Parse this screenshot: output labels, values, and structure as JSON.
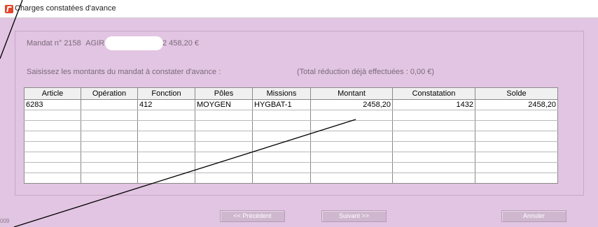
{
  "window": {
    "title": "Charges constatées d'avance",
    "icon": "app-logo-icon"
  },
  "mandat": {
    "label": "Mandat n° 2158",
    "entity": "AGIR",
    "amount": "2 458,20 €"
  },
  "instructions": "Saisissez les montants du mandat à constater d'avance :",
  "total_reduction": "(Total réduction déjà effectuées : 0,00 €)",
  "table": {
    "columns": [
      "Article",
      "Opération",
      "Fonction",
      "Pôles",
      "Missions",
      "Montant",
      "Constatation",
      "Solde"
    ],
    "rows": [
      [
        "6283",
        "",
        "412",
        "MOYGEN",
        "HYGBAT-1",
        "2458,20",
        "1432",
        "2458,20"
      ],
      [
        "",
        "",
        "",
        "",
        "",
        "",
        "",
        ""
      ],
      [
        "",
        "",
        "",
        "",
        "",
        "",
        "",
        ""
      ],
      [
        "",
        "",
        "",
        "",
        "",
        "",
        "",
        ""
      ],
      [
        "",
        "",
        "",
        "",
        "",
        "",
        "",
        ""
      ],
      [
        "",
        "",
        "",
        "",
        "",
        "",
        "",
        ""
      ],
      [
        "",
        "",
        "",
        "",
        "",
        "",
        "",
        ""
      ],
      [
        "",
        "",
        "",
        "",
        "",
        "",
        "",
        ""
      ]
    ]
  },
  "buttons": {
    "previous": "<< Précédent",
    "next": "Suivant >>",
    "cancel": "Annuler"
  },
  "footer_code": "009",
  "colors": {
    "background": "#e2c5e2",
    "button": "#cfb8cf",
    "app_icon": "#e2462b"
  }
}
